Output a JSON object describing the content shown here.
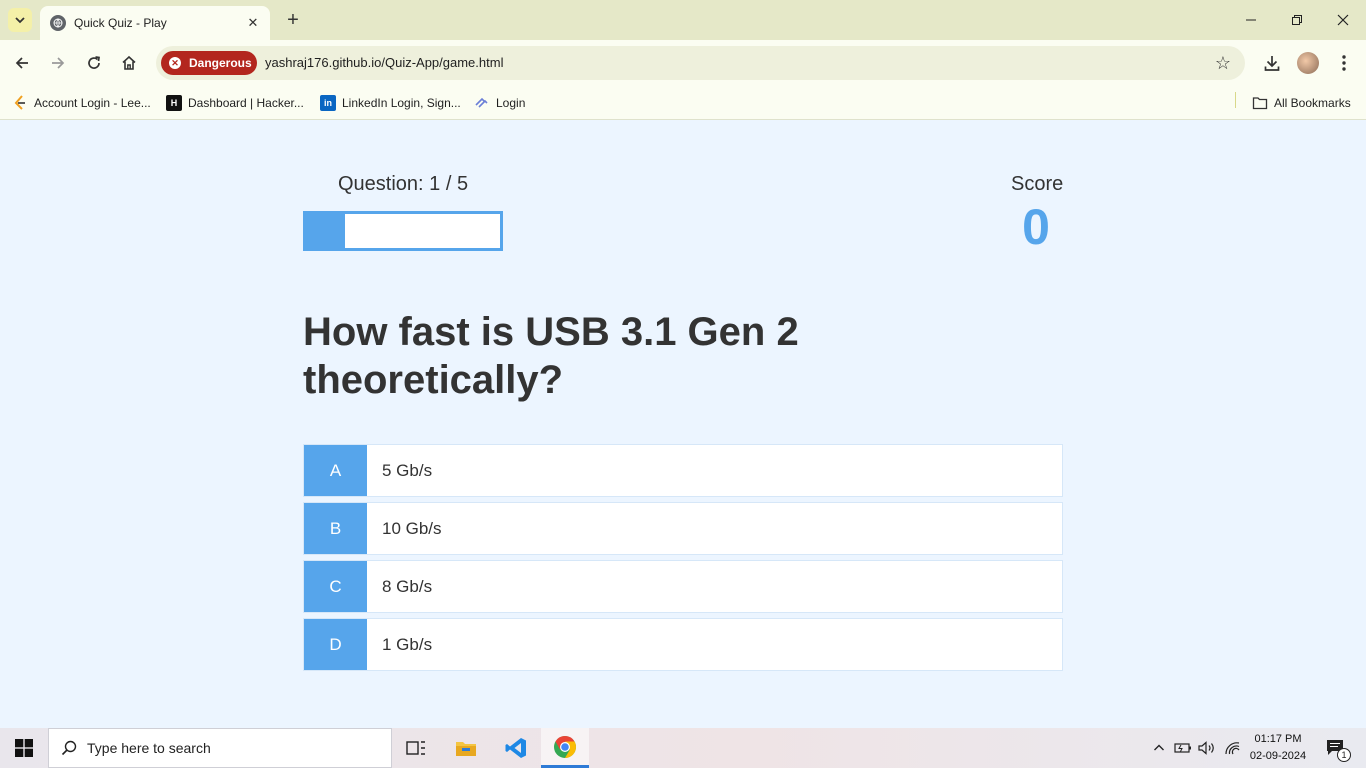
{
  "browser": {
    "tab_title": "Quick Quiz - Play",
    "security_label": "Dangerous",
    "url": "yashraj176.github.io/Quiz-App/game.html",
    "bookmarks": [
      {
        "label": "Account Login - Lee...",
        "icon": "leetcode-icon"
      },
      {
        "label": "Dashboard | Hacker...",
        "icon": "hackerrank-icon"
      },
      {
        "label": "LinkedIn Login, Sign...",
        "icon": "linkedin-icon"
      },
      {
        "label": "Login",
        "icon": "login-site-icon"
      }
    ],
    "all_bookmarks_label": "All Bookmarks"
  },
  "quiz": {
    "progress_text": "Question: 1 / 5",
    "progress_fraction": 0.2,
    "score_label": "Score",
    "score_value": "0",
    "question": "How fast is USB 3.1 Gen 2 theoretically?",
    "choices": [
      {
        "prefix": "A",
        "text": "5 Gb/s"
      },
      {
        "prefix": "B",
        "text": "10 Gb/s"
      },
      {
        "prefix": "C",
        "text": "8 Gb/s"
      },
      {
        "prefix": "D",
        "text": "1 Gb/s"
      }
    ]
  },
  "taskbar": {
    "search_placeholder": "Type here to search",
    "time": "01:17 PM",
    "date": "02-09-2024",
    "notification_count": "1"
  },
  "colors": {
    "accent": "#56a5eb",
    "page_bg": "#ecf5ff",
    "danger": "#b3261e"
  }
}
